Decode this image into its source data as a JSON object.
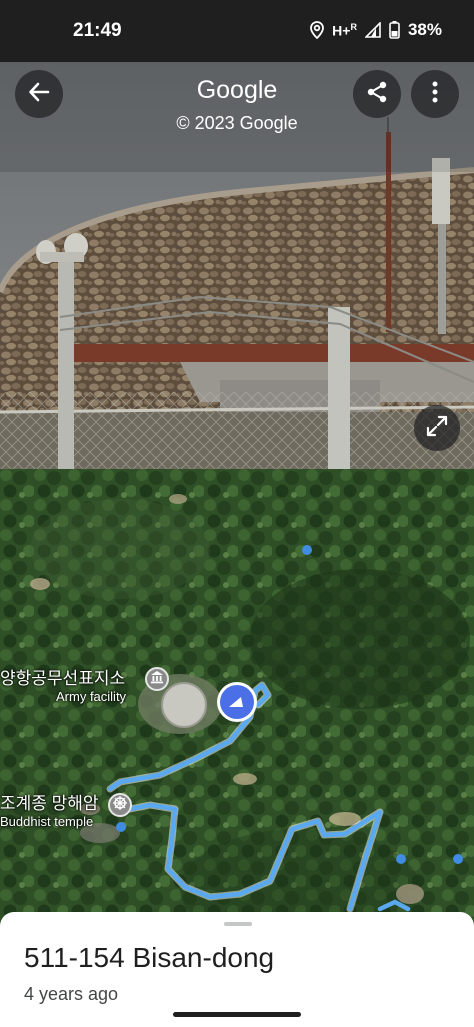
{
  "status_bar": {
    "time": "21:49",
    "network": "H+",
    "roaming": "R",
    "battery": "38%",
    "icons": [
      "location-icon",
      "signal-icon",
      "battery-icon"
    ]
  },
  "streetview": {
    "title": "Google",
    "copyright": "© 2023 Google",
    "icons": [
      "back-arrow-icon",
      "share-icon",
      "more-vert-icon",
      "expand-icon"
    ]
  },
  "map": {
    "places": [
      {
        "name": "양항공무선표지소",
        "type": "Army facility",
        "icon": "museum-icon"
      },
      {
        "name": "조계종 망해암",
        "type": "Buddhist temple",
        "icon": "dharma-wheel-icon"
      }
    ],
    "route_color": "#5aa9f0",
    "location_color": "#4a6fe6"
  },
  "sheet": {
    "title": "511-154 Bisan-dong",
    "subtitle": "4 years ago"
  }
}
